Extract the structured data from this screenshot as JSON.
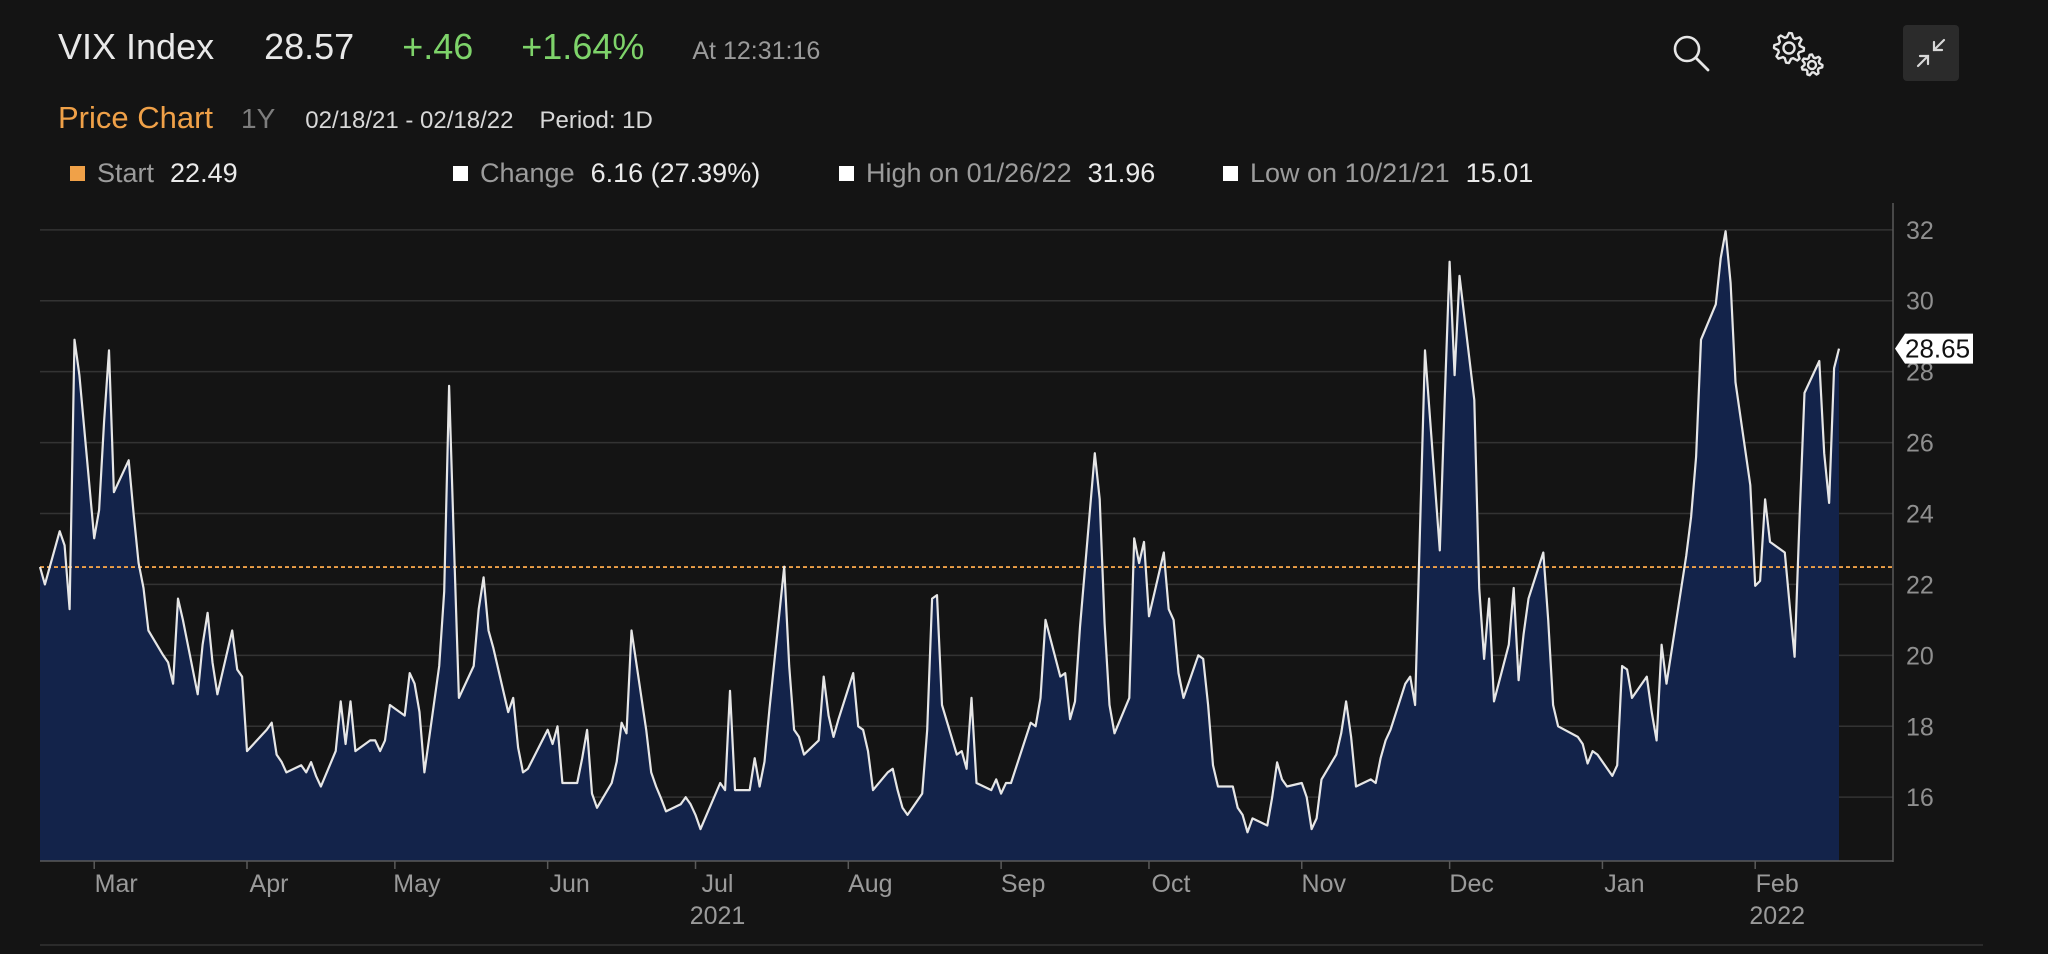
{
  "header": {
    "ticker": "VIX Index",
    "price": "28.57",
    "change": "+.46",
    "change_pct": "+1.64%",
    "time": "At 12:31:16",
    "icons": [
      "search-icon",
      "gear-icon",
      "collapse-icon"
    ]
  },
  "subheader": {
    "title": "Price Chart",
    "range": "1Y",
    "dates": "02/18/21 - 02/18/22",
    "period": "Period: 1D"
  },
  "stats": {
    "start_label": "Start",
    "start_value": "22.49",
    "change_label": "Change",
    "change_value": "6.16 (27.39%)",
    "high_label": "High on 01/26/22",
    "high_value": "31.96",
    "low_label": "Low on 10/21/21",
    "low_value": "15.01"
  },
  "colors": {
    "background": "#141414",
    "area_fill": "#13234a",
    "line": "#e6e6e6",
    "reference_line": "#f0a148",
    "positive": "#7ed36a",
    "accent": "#f0a148"
  },
  "chart_data": {
    "type": "area",
    "ylim": [
      14.2,
      32.7
    ],
    "yticks": [
      16,
      18,
      20,
      22,
      24,
      26,
      28,
      30,
      32
    ],
    "reference_value": 22.49,
    "last_value_label": "28.65",
    "last_value": 28.65,
    "grid": true,
    "y_axis_side": "right",
    "x_range": [
      "2021-02-18",
      "2022-02-18"
    ],
    "month_ticks": [
      {
        "label": "Mar",
        "date": "2021-03-01"
      },
      {
        "label": "Apr",
        "date": "2021-04-01"
      },
      {
        "label": "May",
        "date": "2021-05-01"
      },
      {
        "label": "Jun",
        "date": "2021-06-01"
      },
      {
        "label": "Jul",
        "date": "2021-07-01"
      },
      {
        "label": "Aug",
        "date": "2021-08-01"
      },
      {
        "label": "Sep",
        "date": "2021-09-01"
      },
      {
        "label": "Oct",
        "date": "2021-10-01"
      },
      {
        "label": "Nov",
        "date": "2021-11-01"
      },
      {
        "label": "Dec",
        "date": "2021-12-01"
      },
      {
        "label": "Jan",
        "date": "2022-01-01"
      },
      {
        "label": "Feb",
        "date": "2022-02-01"
      }
    ],
    "year_ticks": [
      {
        "label": "2021",
        "date": "2021-07-01"
      },
      {
        "label": "2022",
        "date": "2022-02-01"
      }
    ],
    "series": [
      {
        "values": [
          [
            "2021-02-18",
            22.49
          ],
          [
            "2021-02-19",
            22.0
          ],
          [
            "2021-02-22",
            23.5
          ],
          [
            "2021-02-23",
            23.1
          ],
          [
            "2021-02-24",
            21.3
          ],
          [
            "2021-02-25",
            28.9
          ],
          [
            "2021-02-26",
            27.9
          ],
          [
            "2021-03-01",
            23.3
          ],
          [
            "2021-03-02",
            24.1
          ],
          [
            "2021-03-03",
            26.6
          ],
          [
            "2021-03-04",
            28.6
          ],
          [
            "2021-03-05",
            24.6
          ],
          [
            "2021-03-08",
            25.5
          ],
          [
            "2021-03-09",
            24.0
          ],
          [
            "2021-03-10",
            22.6
          ],
          [
            "2021-03-11",
            21.9
          ],
          [
            "2021-03-12",
            20.7
          ],
          [
            "2021-03-15",
            20.0
          ],
          [
            "2021-03-16",
            19.8
          ],
          [
            "2021-03-17",
            19.2
          ],
          [
            "2021-03-18",
            21.6
          ],
          [
            "2021-03-19",
            21.0
          ],
          [
            "2021-03-22",
            18.9
          ],
          [
            "2021-03-23",
            20.3
          ],
          [
            "2021-03-24",
            21.2
          ],
          [
            "2021-03-25",
            19.8
          ],
          [
            "2021-03-26",
            18.9
          ],
          [
            "2021-03-29",
            20.7
          ],
          [
            "2021-03-30",
            19.6
          ],
          [
            "2021-03-31",
            19.4
          ],
          [
            "2021-04-01",
            17.3
          ],
          [
            "2021-04-05",
            17.9
          ],
          [
            "2021-04-06",
            18.1
          ],
          [
            "2021-04-07",
            17.2
          ],
          [
            "2021-04-08",
            17.0
          ],
          [
            "2021-04-09",
            16.7
          ],
          [
            "2021-04-12",
            16.9
          ],
          [
            "2021-04-13",
            16.7
          ],
          [
            "2021-04-14",
            16.99
          ],
          [
            "2021-04-15",
            16.6
          ],
          [
            "2021-04-16",
            16.3
          ],
          [
            "2021-04-19",
            17.3
          ],
          [
            "2021-04-20",
            18.7
          ],
          [
            "2021-04-21",
            17.5
          ],
          [
            "2021-04-22",
            18.7
          ],
          [
            "2021-04-23",
            17.3
          ],
          [
            "2021-04-26",
            17.6
          ],
          [
            "2021-04-27",
            17.6
          ],
          [
            "2021-04-28",
            17.3
          ],
          [
            "2021-04-29",
            17.6
          ],
          [
            "2021-04-30",
            18.6
          ],
          [
            "2021-05-03",
            18.3
          ],
          [
            "2021-05-04",
            19.5
          ],
          [
            "2021-05-05",
            19.2
          ],
          [
            "2021-05-06",
            18.4
          ],
          [
            "2021-05-07",
            16.7
          ],
          [
            "2021-05-10",
            19.7
          ],
          [
            "2021-05-11",
            21.8
          ],
          [
            "2021-05-12",
            27.6
          ],
          [
            "2021-05-13",
            23.1
          ],
          [
            "2021-05-14",
            18.8
          ],
          [
            "2021-05-17",
            19.7
          ],
          [
            "2021-05-18",
            21.3
          ],
          [
            "2021-05-19",
            22.2
          ],
          [
            "2021-05-20",
            20.7
          ],
          [
            "2021-05-21",
            20.2
          ],
          [
            "2021-05-24",
            18.4
          ],
          [
            "2021-05-25",
            18.8
          ],
          [
            "2021-05-26",
            17.4
          ],
          [
            "2021-05-27",
            16.7
          ],
          [
            "2021-05-28",
            16.8
          ],
          [
            "2021-06-01",
            17.9
          ],
          [
            "2021-06-02",
            17.5
          ],
          [
            "2021-06-03",
            18.0
          ],
          [
            "2021-06-04",
            16.4
          ],
          [
            "2021-06-07",
            16.4
          ],
          [
            "2021-06-08",
            17.1
          ],
          [
            "2021-06-09",
            17.9
          ],
          [
            "2021-06-10",
            16.1
          ],
          [
            "2021-06-11",
            15.7
          ],
          [
            "2021-06-14",
            16.4
          ],
          [
            "2021-06-15",
            17.0
          ],
          [
            "2021-06-16",
            18.1
          ],
          [
            "2021-06-17",
            17.8
          ],
          [
            "2021-06-18",
            20.7
          ],
          [
            "2021-06-21",
            17.9
          ],
          [
            "2021-06-22",
            16.7
          ],
          [
            "2021-06-23",
            16.3
          ],
          [
            "2021-06-24",
            15.97
          ],
          [
            "2021-06-25",
            15.6
          ],
          [
            "2021-06-28",
            15.8
          ],
          [
            "2021-06-29",
            16.0
          ],
          [
            "2021-06-30",
            15.8
          ],
          [
            "2021-07-01",
            15.5
          ],
          [
            "2021-07-02",
            15.1
          ],
          [
            "2021-07-06",
            16.4
          ],
          [
            "2021-07-07",
            16.2
          ],
          [
            "2021-07-08",
            19.0
          ],
          [
            "2021-07-09",
            16.2
          ],
          [
            "2021-07-12",
            16.2
          ],
          [
            "2021-07-13",
            17.1
          ],
          [
            "2021-07-14",
            16.3
          ],
          [
            "2021-07-15",
            17.0
          ],
          [
            "2021-07-16",
            18.5
          ],
          [
            "2021-07-19",
            22.5
          ],
          [
            "2021-07-20",
            19.7
          ],
          [
            "2021-07-21",
            17.9
          ],
          [
            "2021-07-22",
            17.7
          ],
          [
            "2021-07-23",
            17.2
          ],
          [
            "2021-07-26",
            17.6
          ],
          [
            "2021-07-27",
            19.4
          ],
          [
            "2021-07-28",
            18.3
          ],
          [
            "2021-07-29",
            17.7
          ],
          [
            "2021-07-30",
            18.2
          ],
          [
            "2021-08-02",
            19.5
          ],
          [
            "2021-08-03",
            18.0
          ],
          [
            "2021-08-04",
            17.9
          ],
          [
            "2021-08-05",
            17.3
          ],
          [
            "2021-08-06",
            16.2
          ],
          [
            "2021-08-09",
            16.7
          ],
          [
            "2021-08-10",
            16.8
          ],
          [
            "2021-08-11",
            16.2
          ],
          [
            "2021-08-12",
            15.7
          ],
          [
            "2021-08-13",
            15.5
          ],
          [
            "2021-08-16",
            16.1
          ],
          [
            "2021-08-17",
            17.9
          ],
          [
            "2021-08-18",
            21.6
          ],
          [
            "2021-08-19",
            21.7
          ],
          [
            "2021-08-20",
            18.6
          ],
          [
            "2021-08-23",
            17.2
          ],
          [
            "2021-08-24",
            17.3
          ],
          [
            "2021-08-25",
            16.8
          ],
          [
            "2021-08-26",
            18.8
          ],
          [
            "2021-08-27",
            16.4
          ],
          [
            "2021-08-30",
            16.2
          ],
          [
            "2021-08-31",
            16.5
          ],
          [
            "2021-09-01",
            16.1
          ],
          [
            "2021-09-02",
            16.4
          ],
          [
            "2021-09-03",
            16.4
          ],
          [
            "2021-09-07",
            18.1
          ],
          [
            "2021-09-08",
            18.0
          ],
          [
            "2021-09-09",
            18.8
          ],
          [
            "2021-09-10",
            21.0
          ],
          [
            "2021-09-13",
            19.4
          ],
          [
            "2021-09-14",
            19.5
          ],
          [
            "2021-09-15",
            18.2
          ],
          [
            "2021-09-16",
            18.7
          ],
          [
            "2021-09-17",
            20.8
          ],
          [
            "2021-09-20",
            25.7
          ],
          [
            "2021-09-21",
            24.4
          ],
          [
            "2021-09-22",
            20.9
          ],
          [
            "2021-09-23",
            18.6
          ],
          [
            "2021-09-24",
            17.8
          ],
          [
            "2021-09-27",
            18.8
          ],
          [
            "2021-09-28",
            23.3
          ],
          [
            "2021-09-29",
            22.6
          ],
          [
            "2021-09-30",
            23.2
          ],
          [
            "2021-10-01",
            21.1
          ],
          [
            "2021-10-04",
            22.9
          ],
          [
            "2021-10-05",
            21.3
          ],
          [
            "2021-10-06",
            21.0
          ],
          [
            "2021-10-07",
            19.5
          ],
          [
            "2021-10-08",
            18.8
          ],
          [
            "2021-10-11",
            20.0
          ],
          [
            "2021-10-12",
            19.9
          ],
          [
            "2021-10-13",
            18.6
          ],
          [
            "2021-10-14",
            16.9
          ],
          [
            "2021-10-15",
            16.3
          ],
          [
            "2021-10-18",
            16.3
          ],
          [
            "2021-10-19",
            15.7
          ],
          [
            "2021-10-20",
            15.5
          ],
          [
            "2021-10-21",
            15.01
          ],
          [
            "2021-10-22",
            15.4
          ],
          [
            "2021-10-25",
            15.2
          ],
          [
            "2021-10-26",
            16.0
          ],
          [
            "2021-10-27",
            16.98
          ],
          [
            "2021-10-28",
            16.5
          ],
          [
            "2021-10-29",
            16.3
          ],
          [
            "2021-11-01",
            16.4
          ],
          [
            "2021-11-02",
            16.0
          ],
          [
            "2021-11-03",
            15.1
          ],
          [
            "2021-11-04",
            15.4
          ],
          [
            "2021-11-05",
            16.5
          ],
          [
            "2021-11-08",
            17.2
          ],
          [
            "2021-11-09",
            17.8
          ],
          [
            "2021-11-10",
            18.7
          ],
          [
            "2021-11-11",
            17.7
          ],
          [
            "2021-11-12",
            16.3
          ],
          [
            "2021-11-15",
            16.5
          ],
          [
            "2021-11-16",
            16.4
          ],
          [
            "2021-11-17",
            17.1
          ],
          [
            "2021-11-18",
            17.6
          ],
          [
            "2021-11-19",
            17.9
          ],
          [
            "2021-11-22",
            19.2
          ],
          [
            "2021-11-23",
            19.4
          ],
          [
            "2021-11-24",
            18.6
          ],
          [
            "2021-11-26",
            28.6
          ],
          [
            "2021-11-29",
            22.96
          ],
          [
            "2021-11-30",
            27.2
          ],
          [
            "2021-12-01",
            31.1
          ],
          [
            "2021-12-02",
            27.9
          ],
          [
            "2021-12-03",
            30.7
          ],
          [
            "2021-12-06",
            27.2
          ],
          [
            "2021-12-07",
            21.9
          ],
          [
            "2021-12-08",
            19.9
          ],
          [
            "2021-12-09",
            21.6
          ],
          [
            "2021-12-10",
            18.7
          ],
          [
            "2021-12-13",
            20.3
          ],
          [
            "2021-12-14",
            21.9
          ],
          [
            "2021-12-15",
            19.3
          ],
          [
            "2021-12-16",
            20.6
          ],
          [
            "2021-12-17",
            21.6
          ],
          [
            "2021-12-20",
            22.9
          ],
          [
            "2021-12-21",
            21.0
          ],
          [
            "2021-12-22",
            18.6
          ],
          [
            "2021-12-23",
            18.0
          ],
          [
            "2021-12-27",
            17.7
          ],
          [
            "2021-12-28",
            17.5
          ],
          [
            "2021-12-29",
            16.95
          ],
          [
            "2021-12-30",
            17.3
          ],
          [
            "2021-12-31",
            17.2
          ],
          [
            "2022-01-03",
            16.6
          ],
          [
            "2022-01-04",
            16.9
          ],
          [
            "2022-01-05",
            19.7
          ],
          [
            "2022-01-06",
            19.6
          ],
          [
            "2022-01-07",
            18.8
          ],
          [
            "2022-01-10",
            19.4
          ],
          [
            "2022-01-11",
            18.4
          ],
          [
            "2022-01-12",
            17.6
          ],
          [
            "2022-01-13",
            20.3
          ],
          [
            "2022-01-14",
            19.2
          ],
          [
            "2022-01-18",
            22.8
          ],
          [
            "2022-01-19",
            23.9
          ],
          [
            "2022-01-20",
            25.6
          ],
          [
            "2022-01-21",
            28.9
          ],
          [
            "2022-01-24",
            29.9
          ],
          [
            "2022-01-25",
            31.2
          ],
          [
            "2022-01-26",
            31.96
          ],
          [
            "2022-01-27",
            30.5
          ],
          [
            "2022-01-28",
            27.7
          ],
          [
            "2022-01-31",
            24.8
          ],
          [
            "2022-02-01",
            21.96
          ],
          [
            "2022-02-02",
            22.1
          ],
          [
            "2022-02-03",
            24.4
          ],
          [
            "2022-02-04",
            23.2
          ],
          [
            "2022-02-07",
            22.9
          ],
          [
            "2022-02-08",
            21.4
          ],
          [
            "2022-02-09",
            19.96
          ],
          [
            "2022-02-10",
            23.9
          ],
          [
            "2022-02-11",
            27.4
          ],
          [
            "2022-02-14",
            28.3
          ],
          [
            "2022-02-15",
            25.7
          ],
          [
            "2022-02-16",
            24.3
          ],
          [
            "2022-02-17",
            28.1
          ],
          [
            "2022-02-18",
            28.65
          ]
        ]
      }
    ]
  }
}
